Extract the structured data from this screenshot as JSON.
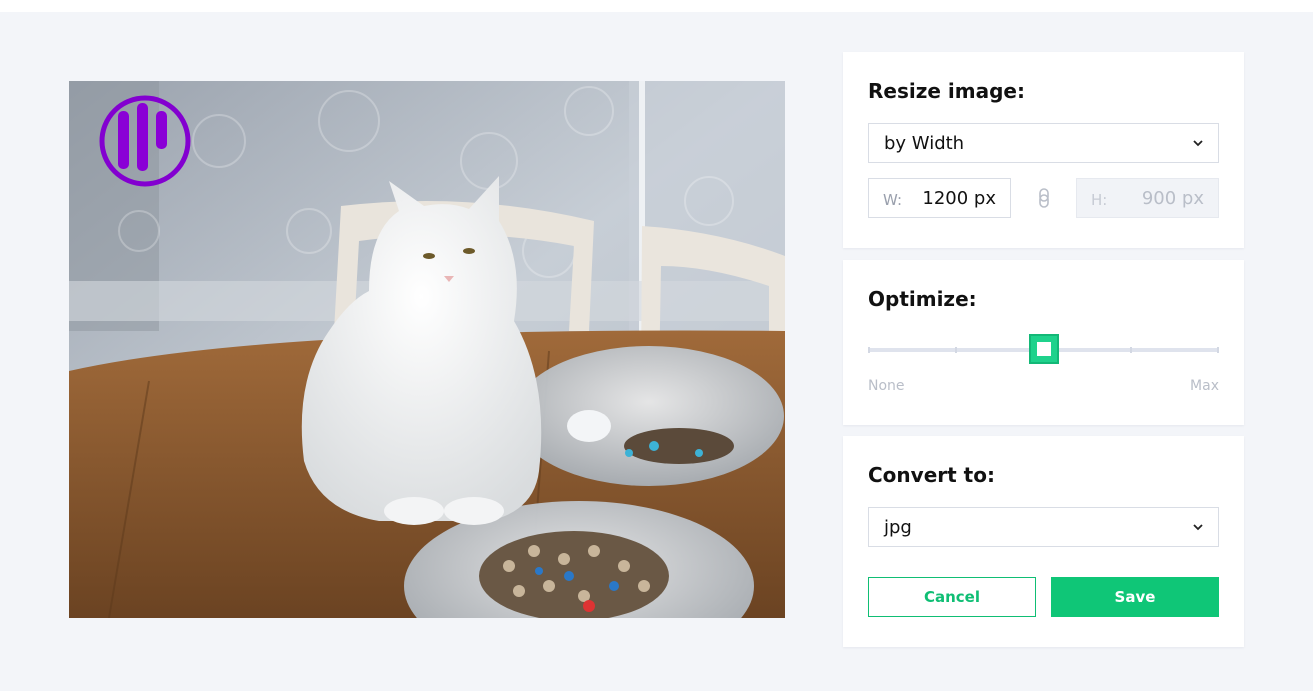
{
  "resize": {
    "title": "Resize image:",
    "mode": "by Width",
    "width_label": "W:",
    "width_value": "1200 px",
    "height_label": "H:",
    "height_value": "900 px"
  },
  "optimize": {
    "title": "Optimize:",
    "min_label": "None",
    "max_label": "Max",
    "level_fraction": 0.5
  },
  "convert": {
    "title": "Convert to:",
    "format": "jpg",
    "cancel_label": "Cancel",
    "save_label": "Save"
  },
  "colors": {
    "accent": "#0fc677",
    "logo": "#7a00c8"
  },
  "icons": {
    "logo": "watermark-logo-icon",
    "chevron": "chevron-down-icon",
    "link": "link-icon"
  }
}
